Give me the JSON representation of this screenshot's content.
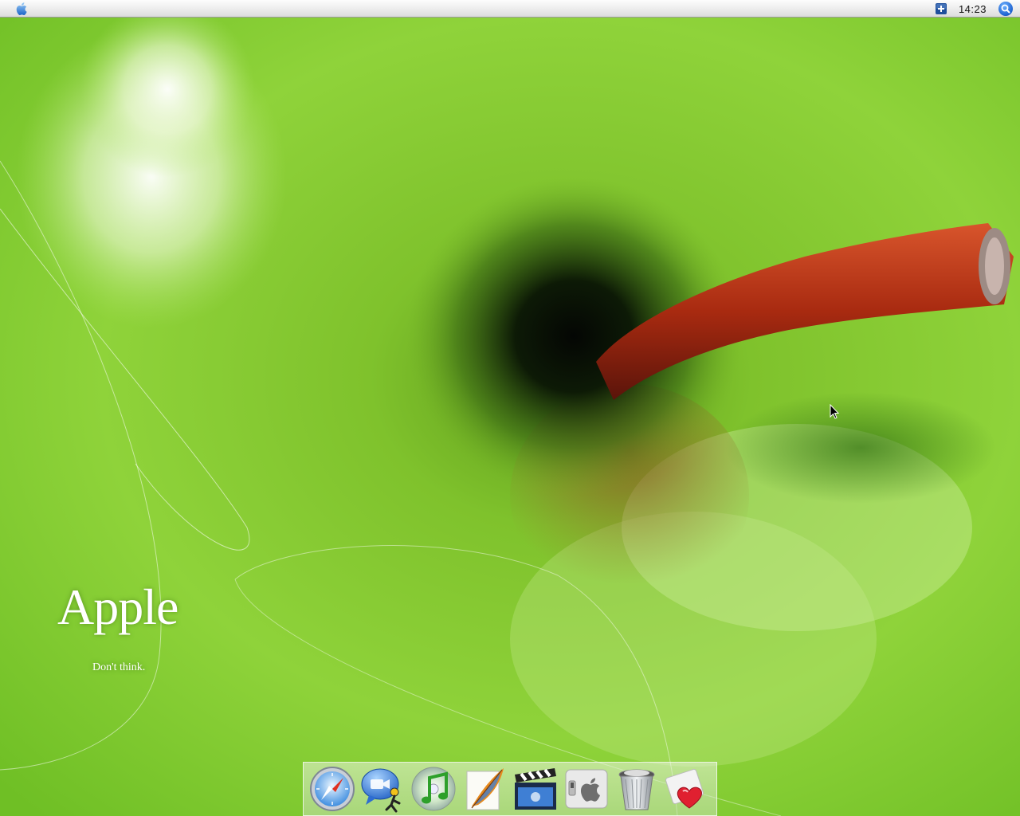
{
  "menubar": {
    "apple_menu_icon": "apple-logo-icon",
    "extra_icon": "plus-box-icon",
    "clock": "14:23",
    "spotlight_icon": "spotlight-search-icon"
  },
  "desktop": {
    "wallpaper": "green-apple-closeup",
    "brand_title": "Apple",
    "brand_tagline": "Don't think."
  },
  "dock": {
    "items": [
      {
        "name": "Safari",
        "icon": "safari-compass-icon"
      },
      {
        "name": "iChat",
        "icon": "ichat-icon"
      },
      {
        "name": "iTunes",
        "icon": "itunes-icon"
      },
      {
        "name": "Feather app",
        "icon": "feather-icon"
      },
      {
        "name": "iMovie",
        "icon": "clapboard-icon"
      },
      {
        "name": "System Preferences",
        "icon": "apple-switch-icon"
      },
      {
        "name": "Trash",
        "icon": "trash-icon"
      },
      {
        "name": "Photo/Heart app",
        "icon": "heart-card-icon"
      }
    ]
  },
  "colors": {
    "wallpaper_green": "#7bc82a",
    "stem_red": "#a82a10",
    "menubar": "#ececec"
  }
}
